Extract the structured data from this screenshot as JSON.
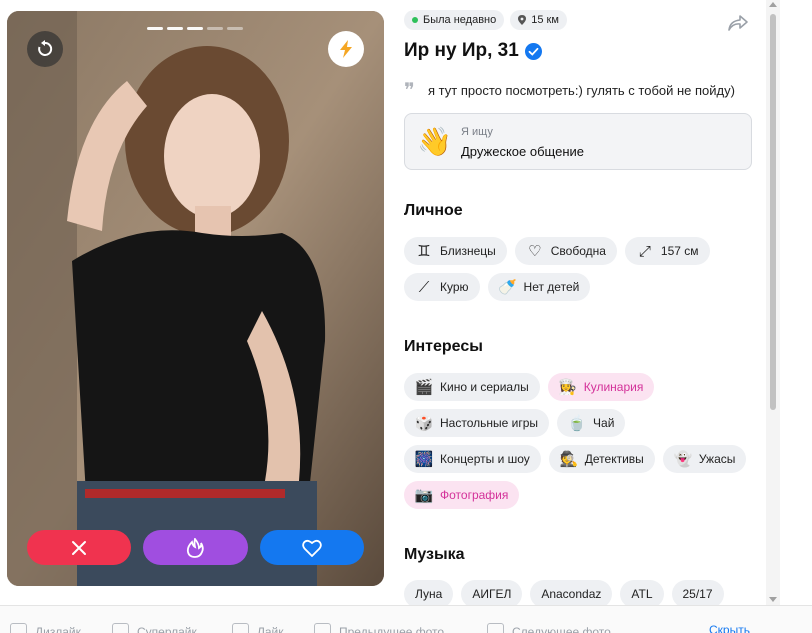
{
  "photo": {
    "page_indicator": {
      "total": 5,
      "active": 3
    },
    "undo_icon": "undo-icon",
    "boost_icon": "lightning-icon",
    "actions": [
      {
        "name": "dislike",
        "icon": "close-icon",
        "color": "#f0334f"
      },
      {
        "name": "superlike",
        "icon": "flame-icon",
        "color": "#a04ee0"
      },
      {
        "name": "like",
        "icon": "heart-icon",
        "color": "#1478f0"
      }
    ]
  },
  "profile": {
    "online_status": "Была недавно",
    "distance": "15 км",
    "name": "Ир ну Ир, 31",
    "verified": true,
    "quote": "я тут просто посмотреть:) гулять с тобой не пойду)",
    "seeking": {
      "emoji": "👋",
      "label": "Я ищу",
      "value": "Дружеское общение"
    },
    "personal": {
      "title": "Личное",
      "rows": [
        [
          {
            "icon": "gemini-icon",
            "glyph": "♊",
            "label": "Близнецы"
          },
          {
            "icon": "heart-outline-icon",
            "glyph": "♡",
            "label": "Свободна"
          },
          {
            "icon": "expand-icon",
            "glyph": "⤢",
            "label": "157 см"
          }
        ],
        [
          {
            "icon": "cigarette-icon",
            "glyph": "⟋",
            "label": "Курю"
          },
          {
            "icon": "baby-bottle-icon",
            "glyph": "🍼",
            "label": "Нет детей"
          }
        ]
      ]
    },
    "interests": {
      "title": "Интересы",
      "rows": [
        [
          {
            "icon": "clapperboard-icon",
            "glyph": "🎬",
            "label": "Кино и сериалы",
            "highlight": false
          },
          {
            "icon": "cook-icon",
            "glyph": "👩‍🍳",
            "label": "Кулинария",
            "highlight": true
          }
        ],
        [
          {
            "icon": "dice-icon",
            "glyph": "🎲",
            "label": "Настольные игры",
            "highlight": false
          },
          {
            "icon": "tea-cup-icon",
            "glyph": "🍵",
            "label": "Чай",
            "highlight": false
          }
        ],
        [
          {
            "icon": "fireworks-icon",
            "glyph": "🎆",
            "label": "Концерты и шоу",
            "highlight": false
          },
          {
            "icon": "detective-icon",
            "glyph": "🕵",
            "label": "Детективы",
            "highlight": false
          },
          {
            "icon": "ghost-icon",
            "glyph": "👻",
            "label": "Ужасы",
            "highlight": false
          }
        ],
        [
          {
            "icon": "camera-icon",
            "glyph": "📷",
            "label": "Фотография",
            "highlight": true
          }
        ]
      ]
    },
    "music": {
      "title": "Музыка",
      "artists": [
        "Луна",
        "АИГЕЛ",
        "Anacondaz",
        "ATL",
        "25/17"
      ]
    }
  },
  "hints": [
    {
      "icon": "key-left-icon",
      "label": "Дизлайк"
    },
    {
      "icon": "key-up-icon",
      "label": "Суперлайк"
    },
    {
      "icon": "key-right-icon",
      "label": "Лайк"
    },
    {
      "icon": "key-back-icon",
      "label": "Предыдущее фото"
    },
    {
      "icon": "key-forward-icon",
      "label": "Следующее фото"
    }
  ],
  "hide_hints": "Скрыть",
  "colors": {
    "accent_blue": "#1478f0",
    "pink": "#d4329a",
    "online": "#2ec05a"
  }
}
